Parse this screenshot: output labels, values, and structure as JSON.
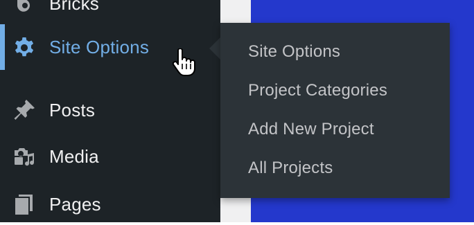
{
  "sidebar": {
    "items": [
      {
        "label": "Bricks",
        "icon": "bricks-icon"
      },
      {
        "label": "Site Options",
        "icon": "gear-icon",
        "active": true
      },
      {
        "label": "Posts",
        "icon": "pin-icon"
      },
      {
        "label": "Media",
        "icon": "media-icon"
      },
      {
        "label": "Pages",
        "icon": "pages-icon"
      }
    ]
  },
  "flyout": {
    "items": [
      {
        "label": "Site Options"
      },
      {
        "label": "Project Categories"
      },
      {
        "label": "Add New Project"
      },
      {
        "label": "All Projects"
      }
    ]
  },
  "colors": {
    "sidebar_bg": "#1d2327",
    "flyout_bg": "#2c3338",
    "accent": "#72aee6",
    "menu_text": "#f0f0f1",
    "flyout_text": "#c3c4c7",
    "blue_panel": "#2438cc"
  },
  "cursor": {
    "icon": "hand-pointer-icon"
  }
}
